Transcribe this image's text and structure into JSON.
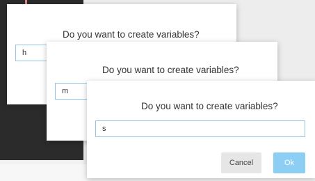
{
  "dialogs": [
    {
      "question": "Do you want to create variables?",
      "input_value": "h"
    },
    {
      "question": "Do you want to create variables?",
      "input_value": "m"
    },
    {
      "question": "Do you want to create variables?",
      "input_value": "s",
      "cancel_label": "Cancel",
      "ok_label": "Ok"
    }
  ],
  "colors": {
    "accent": "#8fc3ea",
    "ok_button": "#8ccef4",
    "indicator": "#d88b8b"
  }
}
